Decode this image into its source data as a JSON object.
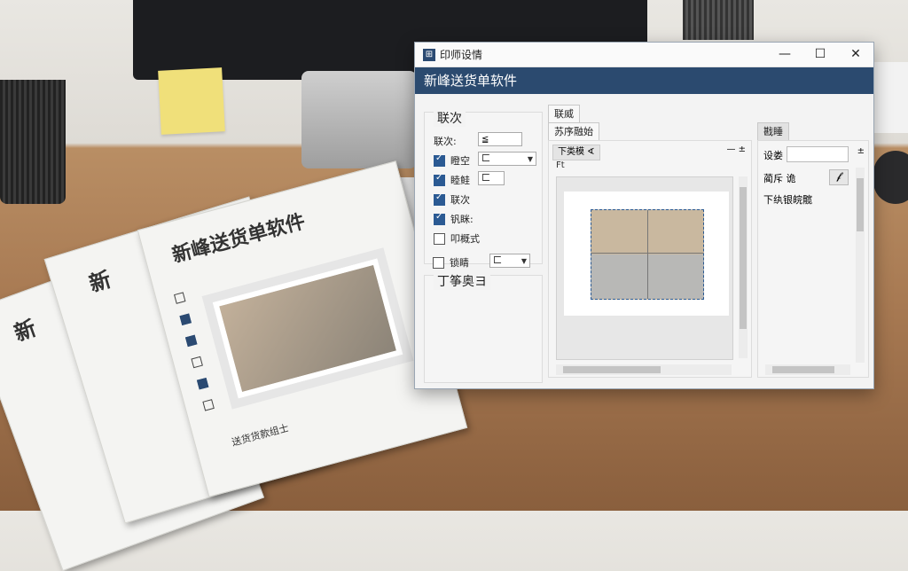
{
  "window": {
    "title": "印师设情",
    "controls": {
      "minimize": "—",
      "maximize": "☐",
      "close": "✕"
    }
  },
  "header": {
    "title": "新峰送货单软件"
  },
  "left": {
    "group_title": "联次",
    "rows": [
      {
        "label": "联次:",
        "checked": null,
        "combo": "≦"
      },
      {
        "label": "瞪空",
        "checked": true,
        "combo": "匚"
      },
      {
        "label": "睦鲑",
        "checked": true,
        "combo": "匚"
      },
      {
        "label": "联次",
        "checked": true
      },
      {
        "label": "钒眯:",
        "checked": true
      },
      {
        "label": "叩概式",
        "checked": false
      },
      {
        "label": "锁睛",
        "checked": false,
        "combo": "匚"
      }
    ],
    "group2_title": "丁筝奥ヨ"
  },
  "middle": {
    "tab": "联威",
    "subtab": "苏序融始",
    "inner_tab": "下类模 ∢",
    "corner_controls": "— ±",
    "ft_label": "Ft"
  },
  "right": {
    "tab": "戡睡",
    "field_label": "设娄",
    "row2_label": "蔺斥  诡",
    "row2_btn": "𝓯",
    "row3_label": "下纨银皖髋",
    "plus": "±"
  },
  "papers": {
    "title": "新峰送货单软件",
    "title_short": "新",
    "footer": "送货货款组士"
  }
}
